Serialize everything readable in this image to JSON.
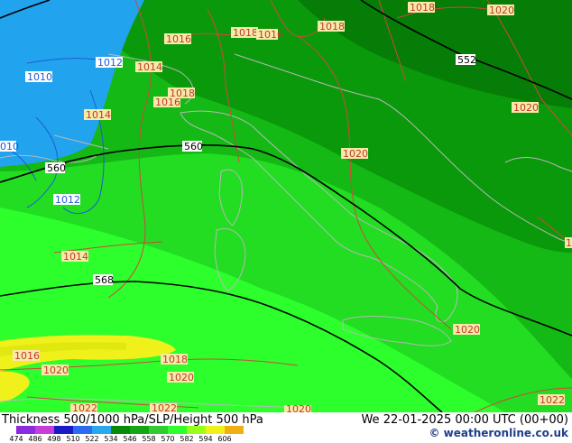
{
  "map": {
    "height_labels": [
      "560",
      "560",
      "568",
      "552"
    ],
    "isobar_labels_red": [
      "1016",
      "1018",
      "1016",
      "1018",
      "1014",
      "1018",
      "1016",
      "1014",
      "1020",
      "1014",
      "1016",
      "1020",
      "1018",
      "1020",
      "1022",
      "1022",
      "1020",
      "1020",
      "1018",
      "1020",
      "1020",
      "1022",
      "1018"
    ],
    "isobar_labels_blue": [
      "1010",
      "1012",
      "1012",
      "010"
    ]
  },
  "footer": {
    "title": "Thickness 500/1000 hPa/SLP/Height 500 hPa",
    "datetime": "We 22-01-2025 00:00 UTC (00+00)",
    "credit": "© weatheronline.co.uk"
  },
  "scale": {
    "ticks": [
      "474",
      "486",
      "498",
      "510",
      "522",
      "534",
      "546",
      "558",
      "570",
      "582",
      "594",
      "606"
    ],
    "colors": [
      "#8a2be2",
      "#c83cd8",
      "#1a1ac8",
      "#2a6bf0",
      "#29a8f0",
      "#0a8a0a",
      "#13a813",
      "#30cc30",
      "#2cff2c",
      "#9aff1a",
      "#f0f01a",
      "#f0b014"
    ]
  }
}
